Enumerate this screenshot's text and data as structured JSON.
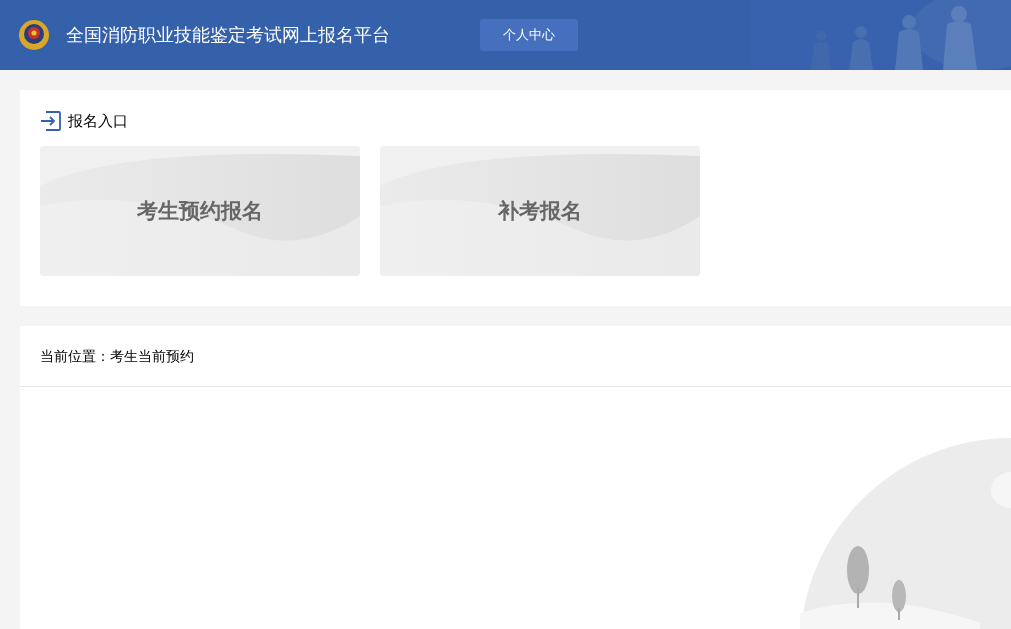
{
  "header": {
    "title": "全国消防职业技能鉴定考试网上报名平台",
    "nav_button": "个人中心"
  },
  "entry_panel": {
    "heading": "报名入口",
    "cards": [
      {
        "label": "考生预约报名"
      },
      {
        "label": "补考报名"
      }
    ]
  },
  "content_panel": {
    "breadcrumb": "当前位置：考生当前预约"
  }
}
